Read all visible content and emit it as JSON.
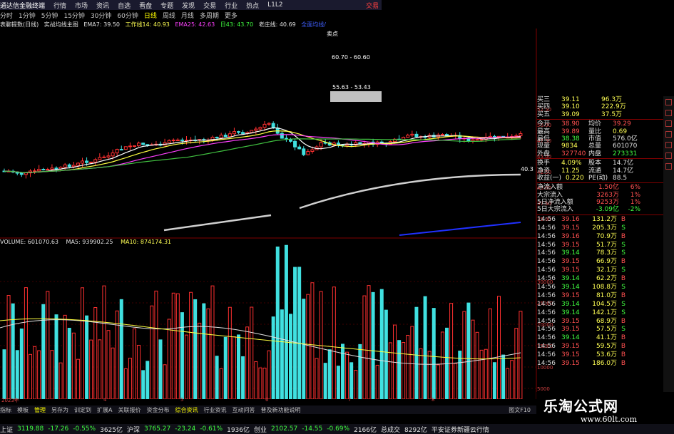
{
  "titlebar": {
    "app": "通达信金融终端",
    "menus": [
      "行情",
      "市场",
      "资讯",
      "自选",
      "看盘",
      "专题",
      "发现",
      "交易",
      "行业",
      "热点",
      "L1L2"
    ],
    "right_label": "交易"
  },
  "periodbar": {
    "items": [
      "分时",
      "1分钟",
      "5分钟",
      "15分钟",
      "30分钟",
      "60分钟",
      "日线",
      "周线",
      "月线",
      "多周期",
      "更多"
    ],
    "selected": "日线"
  },
  "indicator_bar": {
    "name": "表聊提数(日线)",
    "main": "实战均线主图",
    "ema7": "EMA7: 39.50",
    "line14": "工作线14: 40.93",
    "ema25": "EMA25: 42.63",
    "line43": "日43: 43.70",
    "line_old": "老庄线: 40.69",
    "extra": "全面均线/"
  },
  "chart_labels": {
    "peak": "卖点",
    "range1": "60.70 - 60.60",
    "range2": "55.63 - 53.43",
    "right_price": "40.3"
  },
  "vol_bar": {
    "volume": "VOLUME: 601070.63",
    "ma5": "MA5: 939902.25",
    "ma10": "MA10: 874174.31"
  },
  "price_axis": [
    "52.50",
    "50.00",
    "47.50",
    "45.00",
    "42.50",
    "40.00",
    "37.50",
    "35.00"
  ],
  "vol_axis": [
    "30000",
    "25000",
    "20000",
    "15000",
    "10000",
    "5000"
  ],
  "x_axis": [
    "2023年",
    "4",
    "5",
    "6",
    "7",
    "8"
  ],
  "quote_panel": {
    "rows_top": [
      {
        "k": "买三",
        "v": "39.11",
        "n": "96.3万"
      },
      {
        "k": "买四",
        "v": "39.10",
        "n": "222.9万"
      },
      {
        "k": "买五",
        "v": "39.09",
        "n": "37.5万"
      }
    ],
    "rows_mid": [
      {
        "k": "今开",
        "v": "38.90",
        "k2": "均价",
        "v2": "39.29"
      },
      {
        "k": "最高",
        "v": "39.89",
        "k2": "量比",
        "v2": "0.69"
      },
      {
        "k": "最低",
        "v": "38.38",
        "k2": "市值",
        "v2": "576.0亿"
      },
      {
        "k": "现量",
        "v": "9834",
        "k2": "总量",
        "v2": "601070"
      },
      {
        "k": "外盘",
        "v": "327740",
        "k2": "内盘",
        "v2": "273331"
      }
    ],
    "rows_low": [
      {
        "k": "换手",
        "v": "4.09%",
        "k2": "股本",
        "v2": "14.7亿"
      },
      {
        "k": "净资",
        "v": "11.25",
        "k2": "流通",
        "v2": "14.7亿"
      },
      {
        "k": "收益(一)",
        "v": "0.220",
        "k2": "PE(动)",
        "v2": "88.5"
      }
    ],
    "flows": [
      {
        "k": "净流入额",
        "v": "1.50亿",
        "p": "6%"
      },
      {
        "k": "大宗流入",
        "v": "3263万",
        "p": "1%"
      },
      {
        "k": "5日净流入额",
        "v": "9253万",
        "p": "1%"
      },
      {
        "k": "5日大宗流入",
        "v": "-3.09亿",
        "p": "-2%"
      }
    ],
    "trades": [
      {
        "t": "14:56",
        "p": "39.16",
        "v": "131.2万",
        "s": "B"
      },
      {
        "t": "14:56",
        "p": "39.15",
        "v": "205.3万",
        "s": "S"
      },
      {
        "t": "14:56",
        "p": "39.16",
        "v": "70.9万",
        "s": "B"
      },
      {
        "t": "14:56",
        "p": "39.15",
        "v": "51.7万",
        "s": "S"
      },
      {
        "t": "14:56",
        "p": "39.14",
        "v": "78.3万",
        "s": "S"
      },
      {
        "t": "14:56",
        "p": "39.15",
        "v": "66.9万",
        "s": "B"
      },
      {
        "t": "14:56",
        "p": "39.15",
        "v": "32.1万",
        "s": "S"
      },
      {
        "t": "14:56",
        "p": "39.14",
        "v": "62.2万",
        "s": "B"
      },
      {
        "t": "14:56",
        "p": "39.14",
        "v": "108.8万",
        "s": "S"
      },
      {
        "t": "14:56",
        "p": "39.15",
        "v": "81.0万",
        "s": "B"
      },
      {
        "t": "14:56",
        "p": "39.14",
        "v": "104.5万",
        "s": "S"
      },
      {
        "t": "14:56",
        "p": "39.14",
        "v": "142.1万",
        "s": "S"
      },
      {
        "t": "14:56",
        "p": "39.15",
        "v": "68.9万",
        "s": "B"
      },
      {
        "t": "14:56",
        "p": "39.15",
        "v": "57.5万",
        "s": "S"
      },
      {
        "t": "14:56",
        "p": "39.14",
        "v": "41.1万",
        "s": "B"
      },
      {
        "t": "14:56",
        "p": "39.15",
        "v": "59.5万",
        "s": "B"
      },
      {
        "t": "14:56",
        "p": "39.15",
        "v": "53.6万",
        "s": "B"
      },
      {
        "t": "14:56",
        "p": "39.15",
        "v": "186.0万",
        "s": "B"
      }
    ]
  },
  "bottom_tabs": [
    "指标",
    "模板",
    "管理",
    "另存为",
    "训定到",
    "扩展A",
    "关联报价",
    "资金分布",
    "综合资讯",
    "行业资讯",
    "互动问答",
    "普及新功能说明"
  ],
  "bottom_tabs_selected": "管理",
  "bottom_right": "图文F10",
  "statusbar": {
    "sh_label": "上证",
    "sh_val": "3119.88",
    "sh_chg": "-17.26",
    "sh_pct": "-0.55%",
    "sh_amt": "3625亿",
    "hs_label": "沪深",
    "hs_val": "3765.27",
    "hs_chg": "-23.24",
    "hs_pct": "-0.61%",
    "hs_amt": "1936亿",
    "cy_label": "创业",
    "cy_val": "2102.57",
    "cy_chg": "-14.55",
    "cy_pct": "-0.69%",
    "cy_amt": "2166亿",
    "total_label": "总成交",
    "total_amt": "8292亿",
    "broker": "平安证券新疆云行情"
  },
  "watermark": {
    "title": "乐淘公式网",
    "url": "www.60lt.com"
  },
  "colors": {
    "up": "#ff3030",
    "down": "#40e0e0",
    "ema7": "#ffffff",
    "line14": "#ffff40",
    "ema25": "#ff40ff",
    "line43": "#40c040",
    "old": "#d0d0d0"
  }
}
